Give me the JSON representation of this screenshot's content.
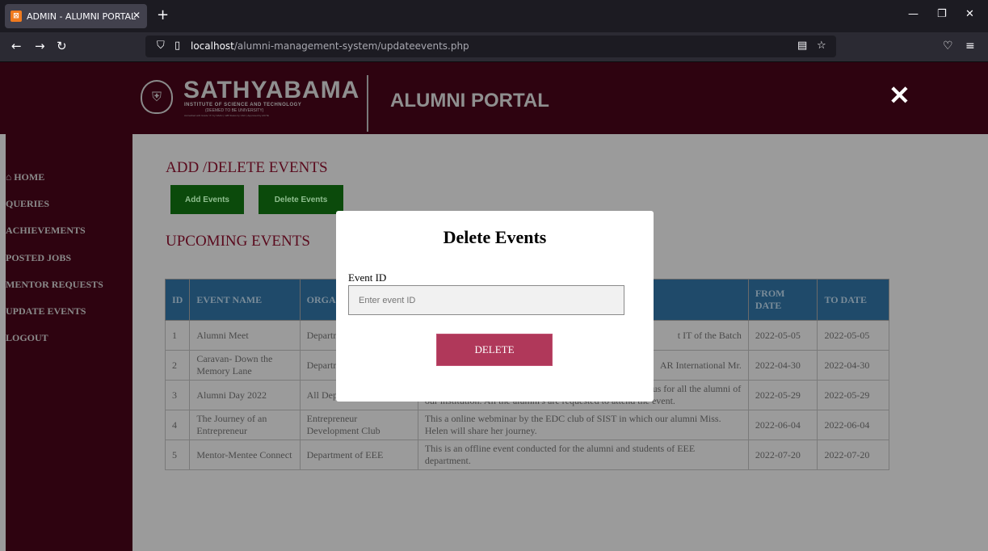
{
  "browser": {
    "tab_title": "ADMIN - ALUMNI PORTAL",
    "tab_favicon": "xampp-icon",
    "url_host": "localhost",
    "url_path": "/alumni-management-system/updateevents.php"
  },
  "header": {
    "logo_name": "SATHYABAMA",
    "logo_subtitle": "INSTITUTE OF SCIENCE AND TECHNOLOGY",
    "logo_deemed": "(DEEMED TO BE UNIVERSITY)",
    "logo_accreditation": "Accredited with Grade \"A\" by NAAC | 12B Status by UGC | Approved by AICTE",
    "portal_title": "ALUMNI PORTAL",
    "close_symbol": "✕"
  },
  "sidebar": {
    "items": [
      {
        "label": "HOME",
        "icon": "home-icon"
      },
      {
        "label": "QUERIES"
      },
      {
        "label": "ACHIEVEMENTS"
      },
      {
        "label": "POSTED JOBS"
      },
      {
        "label": "MENTOR REQUESTS"
      },
      {
        "label": "UPDATE EVENTS"
      },
      {
        "label": "LOGOUT"
      }
    ]
  },
  "main": {
    "heading": "ADD /DELETE EVENTS",
    "add_button": "Add Events",
    "delete_button": "Delete Events",
    "upcoming_heading": "UPCOMING EVENTS"
  },
  "table": {
    "headers": [
      "ID",
      "EVENT NAME",
      "ORGA",
      "",
      "FROM DATE",
      "TO DATE"
    ],
    "rows": [
      {
        "id": "1",
        "name": "Alumni Meet",
        "org": "Departm Informa",
        "desc": "t IT of the Batch",
        "from": "2022-05-05",
        "to": "2022-05-05"
      },
      {
        "id": "2",
        "name": "Caravan- Down the Memory Lane",
        "org": "Departm",
        "desc": "AR International Mr.",
        "from": "2022-04-30",
        "to": "2022-04-30"
      },
      {
        "id": "3",
        "name": "Alumni Day 2022",
        "org": "All Departments",
        "desc": "Alumni Day 2022 is a offline alumni meet inside the campus for all the alumni of our institution. All the alumni's are requested to attend the event.",
        "from": "2022-05-29",
        "to": "2022-05-29"
      },
      {
        "id": "4",
        "name": "The Journey of an Entrepreneur",
        "org": "Entrepreneur Development Club",
        "desc": "This a online webminar by the EDC club of SIST in which our alumni Miss. Helen will share her journey.",
        "from": "2022-06-04",
        "to": "2022-06-04"
      },
      {
        "id": "5",
        "name": "Mentor-Mentee Connect",
        "org": "Department of EEE",
        "desc": "This is an offline event conducted for the alumni and students of EEE department.",
        "from": "2022-07-20",
        "to": "2022-07-20"
      }
    ]
  },
  "modal": {
    "title": "Delete Events",
    "label": "Event ID",
    "placeholder": "Enter event ID",
    "value": "",
    "button": "DELETE"
  }
}
